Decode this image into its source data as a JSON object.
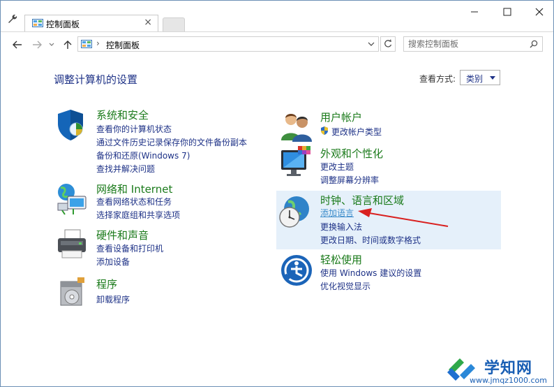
{
  "tab": {
    "title": "控制面板",
    "close": "×"
  },
  "address": {
    "separator": "›",
    "path": "控制面板"
  },
  "search": {
    "placeholder": "搜索控制面板"
  },
  "page": {
    "title": "调整计算机的设置"
  },
  "view_by": {
    "label": "查看方式:",
    "selected": "类别"
  },
  "left_categories": [
    {
      "title": "系统和安全",
      "icon": "shield-icon",
      "links": [
        "查看你的计算机状态",
        "通过文件历史记录保存你的文件备份副本",
        "备份和还原(Windows 7)",
        "查找并解决问题"
      ]
    },
    {
      "title": "网络和 Internet",
      "icon": "network-globe-icon",
      "links": [
        "查看网络状态和任务",
        "选择家庭组和共享选项"
      ]
    },
    {
      "title": "硬件和声音",
      "icon": "printer-icon",
      "links": [
        "查看设备和打印机",
        "添加设备"
      ]
    },
    {
      "title": "程序",
      "icon": "programs-disc-icon",
      "links": [
        "卸载程序"
      ]
    }
  ],
  "right_categories": [
    {
      "title": "用户帐户",
      "icon": "users-icon",
      "links": [
        "更改帐户类型"
      ]
    },
    {
      "title": "外观和个性化",
      "icon": "monitor-palette-icon",
      "links": [
        "更改主题",
        "调整屏幕分辨率"
      ]
    },
    {
      "title": "时钟、语言和区域",
      "icon": "clock-globe-icon",
      "links": [
        "添加语言",
        "更换输入法",
        "更改日期、时间或数字格式"
      ]
    },
    {
      "title": "轻松使用",
      "icon": "ease-of-access-icon",
      "links": [
        "使用 Windows 建议的设置",
        "优化视觉显示"
      ]
    }
  ],
  "watermark": {
    "name": "学知网",
    "url": "www.jmqz1000.com"
  },
  "colors": {
    "category_title": "#1a7a1a",
    "link": "#1e3287",
    "highlight": "#e5f0fa",
    "annotation_arrow": "#d9201f"
  }
}
